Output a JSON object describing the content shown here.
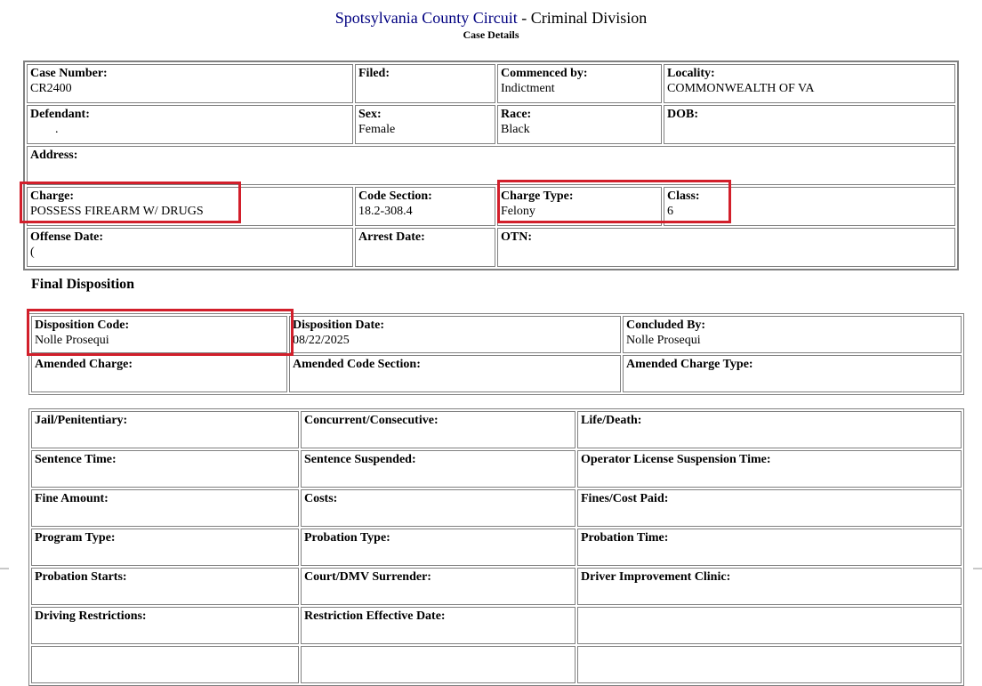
{
  "header": {
    "court": "Spotsylvania County Circuit",
    "separator": " - ",
    "division": "Criminal Division",
    "subtitle": "Case Details"
  },
  "case": {
    "case_number_label": "Case Number:",
    "case_number": "CR2400",
    "filed_label": "Filed:",
    "filed": "",
    "commenced_label": "Commenced by:",
    "commenced": "Indictment",
    "locality_label": "Locality:",
    "locality": "COMMONWEALTH OF VA",
    "defendant_label": "Defendant:",
    "defendant": "        .",
    "sex_label": "Sex:",
    "sex": "Female",
    "race_label": "Race:",
    "race": "Black",
    "dob_label": "DOB:",
    "dob": "",
    "address_label": "Address:",
    "address": "",
    "charge_label": "Charge:",
    "charge": "POSSESS FIREARM W/ DRUGS",
    "code_section_label": "Code Section:",
    "code_section": "18.2-308.4",
    "charge_type_label": "Charge Type:",
    "charge_type": "Felony",
    "class_label": "Class:",
    "class": "6",
    "offense_date_label": "Offense Date:",
    "offense_date": "(",
    "arrest_date_label": "Arrest Date:",
    "arrest_date": "",
    "otn_label": "OTN:",
    "otn": ""
  },
  "final_disposition": {
    "title": "Final Disposition",
    "disposition_code_label": "Disposition Code:",
    "disposition_code": "Nolle Prosequi",
    "disposition_date_label": "Disposition Date:",
    "disposition_date": "08/22/2025",
    "concluded_by_label": "Concluded By:",
    "concluded_by": "Nolle Prosequi",
    "amended_charge_label": "Amended Charge:",
    "amended_code_section_label": "Amended Code Section:",
    "amended_charge_type_label": "Amended Charge Type:"
  },
  "sentence": {
    "jail_label": "Jail/Penitentiary:",
    "concurrent_label": "Concurrent/Consecutive:",
    "life_death_label": "Life/Death:",
    "sentence_time_label": "Sentence Time:",
    "sentence_suspended_label": "Sentence Suspended:",
    "operator_license_label": "Operator License Suspension Time:",
    "fine_amount_label": "Fine Amount:",
    "costs_label": "Costs:",
    "fines_cost_paid_label": "Fines/Cost Paid:",
    "program_type_label": "Program Type:",
    "probation_type_label": "Probation Type:",
    "probation_time_label": "Probation Time:",
    "probation_starts_label": "Probation Starts:",
    "court_dmv_label": "Court/DMV Surrender:",
    "driver_clinic_label": "Driver Improvement Clinic:",
    "driving_restrictions_label": "Driving Restrictions:",
    "restriction_effective_label": "Restriction Effective Date:"
  },
  "colors": {
    "highlight": "#d21f2b",
    "court_link": "#000080",
    "border": "#808080"
  }
}
